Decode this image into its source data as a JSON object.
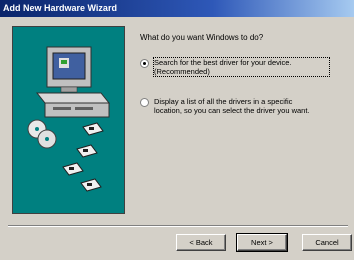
{
  "window": {
    "title": "Add New Hardware Wizard"
  },
  "prompt": "What do you want Windows to do?",
  "options": [
    {
      "line1": "Search for the best driver for your device.",
      "line2": "(Recommended)",
      "selected": true
    },
    {
      "line1": "Display a list of all the drivers in a specific",
      "line2": "location, so you can select the driver you want.",
      "selected": false
    }
  ],
  "buttons": {
    "back": "< Back",
    "next": "Next >",
    "cancel": "Cancel"
  },
  "colors": {
    "title_bar": "#0a246a",
    "art_background": "#008080",
    "dialog_face": "#d4d0c8"
  }
}
